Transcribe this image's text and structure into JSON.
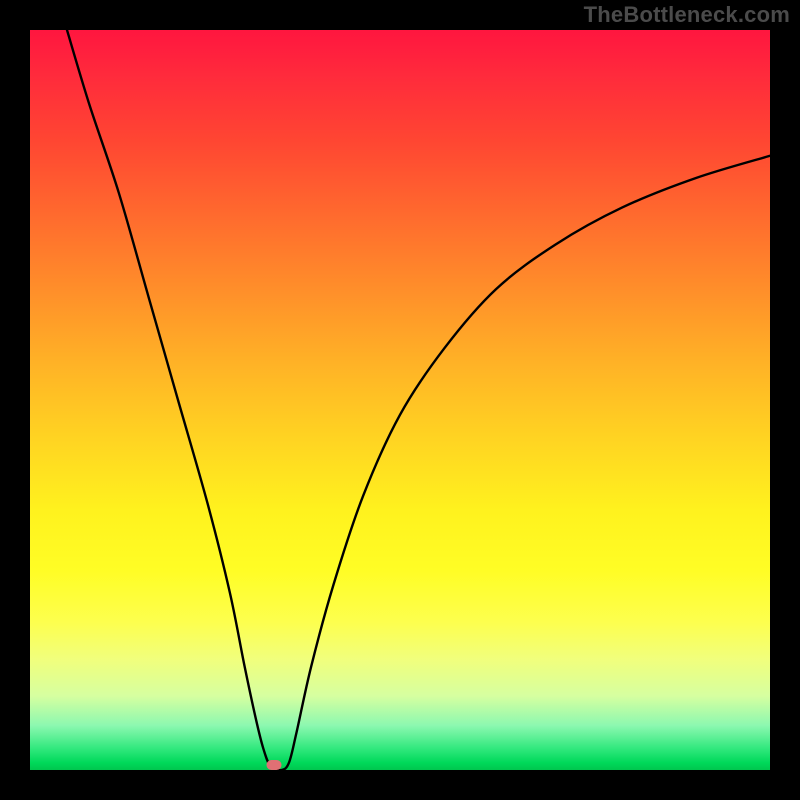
{
  "watermark_text": "TheBottleneck.com",
  "marker_color": "#e07074",
  "chart_data": {
    "type": "line",
    "title": "",
    "xlabel": "",
    "ylabel": "",
    "xlim": [
      0,
      100
    ],
    "ylim": [
      0,
      100
    ],
    "x_bottom": 33,
    "curve_left": [
      {
        "x": 5,
        "y": 100
      },
      {
        "x": 8,
        "y": 90
      },
      {
        "x": 12,
        "y": 78
      },
      {
        "x": 16,
        "y": 64
      },
      {
        "x": 20,
        "y": 50
      },
      {
        "x": 24,
        "y": 36
      },
      {
        "x": 27,
        "y": 24
      },
      {
        "x": 29,
        "y": 14
      },
      {
        "x": 30.5,
        "y": 7
      },
      {
        "x": 31.5,
        "y": 3
      },
      {
        "x": 32.5,
        "y": 0.5
      },
      {
        "x": 34,
        "y": 0
      }
    ],
    "curve_right": [
      {
        "x": 34,
        "y": 0
      },
      {
        "x": 35,
        "y": 1
      },
      {
        "x": 36,
        "y": 5
      },
      {
        "x": 38,
        "y": 14
      },
      {
        "x": 41,
        "y": 25
      },
      {
        "x": 45,
        "y": 37
      },
      {
        "x": 50,
        "y": 48
      },
      {
        "x": 56,
        "y": 57
      },
      {
        "x": 63,
        "y": 65
      },
      {
        "x": 71,
        "y": 71
      },
      {
        "x": 80,
        "y": 76
      },
      {
        "x": 90,
        "y": 80
      },
      {
        "x": 100,
        "y": 83
      }
    ]
  }
}
